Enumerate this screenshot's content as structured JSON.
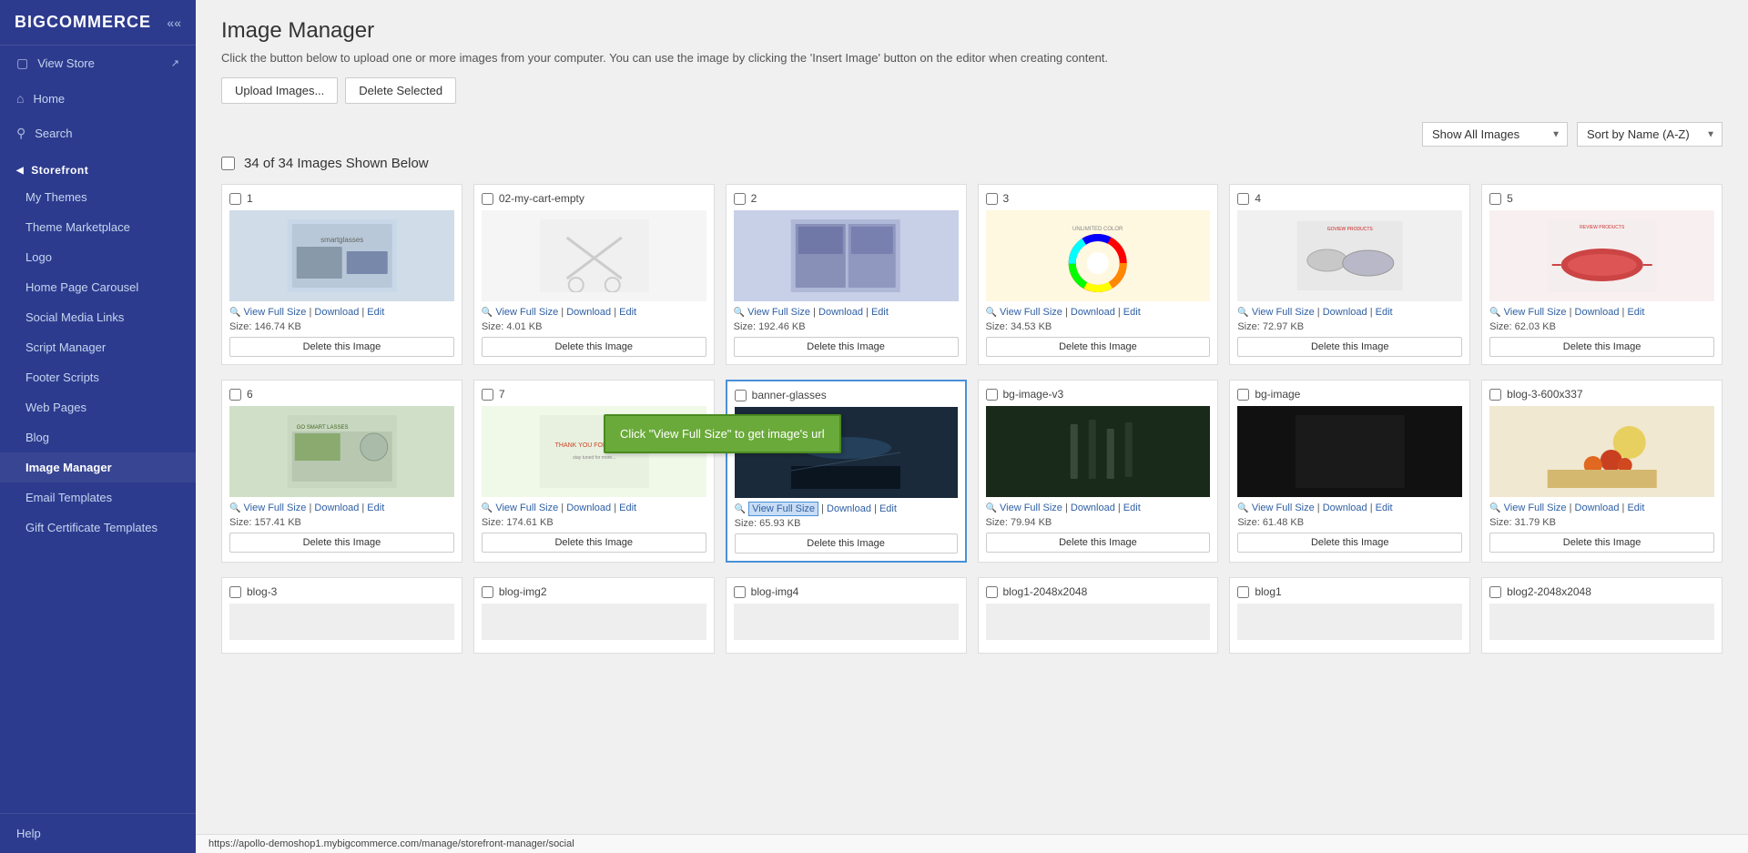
{
  "sidebar": {
    "logo": "BIGCOMMERCE",
    "collapse_icon": "««",
    "nav_items": [
      {
        "id": "view-store",
        "label": "View Store",
        "icon": "🏪"
      },
      {
        "id": "home",
        "label": "Home",
        "icon": "🏠"
      },
      {
        "id": "search",
        "label": "Search",
        "icon": "🔍"
      }
    ],
    "storefront_section": "Storefront",
    "storefront_items": [
      {
        "id": "my-themes",
        "label": "My Themes"
      },
      {
        "id": "theme-marketplace",
        "label": "Theme Marketplace"
      },
      {
        "id": "logo",
        "label": "Logo"
      },
      {
        "id": "home-page-carousel",
        "label": "Home Page Carousel"
      },
      {
        "id": "social-media-links",
        "label": "Social Media Links"
      },
      {
        "id": "script-manager",
        "label": "Script Manager"
      },
      {
        "id": "footer-scripts",
        "label": "Footer Scripts"
      },
      {
        "id": "web-pages",
        "label": "Web Pages"
      },
      {
        "id": "blog",
        "label": "Blog"
      },
      {
        "id": "image-manager",
        "label": "Image Manager",
        "active": true
      },
      {
        "id": "email-templates",
        "label": "Email Templates"
      },
      {
        "id": "gift-certificate-templates",
        "label": "Gift Certificate Templates"
      }
    ],
    "footer_label": "Help"
  },
  "page": {
    "title": "Image Manager",
    "description": "Click the button below to upload one or more images from your computer. You can use the image by clicking the 'Insert Image' button on the editor when creating content.",
    "upload_btn": "Upload Images...",
    "delete_selected_btn": "Delete Selected"
  },
  "filters": {
    "show_filter": "Show All Images",
    "sort_filter": "Sort by Name (A-Z)"
  },
  "images_count": "34 of 34 Images Shown Below",
  "tooltip_text": "Click \"View Full Size\" to get image's url",
  "row1": [
    {
      "name": "1",
      "size": "Size: 146.74 KB",
      "delete_label": "Delete this Image",
      "links": "View Full Size | Download | Edit",
      "color": "#d8e8f0"
    },
    {
      "name": "02-my-cart-empty",
      "size": "Size: 4.01 KB",
      "delete_label": "Delete this Image",
      "links": "View Full Size | Download | Edit",
      "color": "#f5f5f5"
    },
    {
      "name": "2",
      "size": "Size: 192.46 KB",
      "delete_label": "Delete this Image",
      "links": "View Full Size | Download | Edit",
      "color": "#d0d8f0"
    },
    {
      "name": "3",
      "size": "Size: 34.53 KB",
      "delete_label": "Delete this Image",
      "links": "View Full Size | Download | Edit",
      "color": "#fff5e0"
    },
    {
      "name": "4",
      "size": "Size: 72.97 KB",
      "delete_label": "Delete this Image",
      "links": "View Full Size | Download | Edit",
      "color": "#f0f0f0"
    },
    {
      "name": "5",
      "size": "Size: 62.03 KB",
      "delete_label": "Delete this Image",
      "links": "View Full Size | Download | Edit",
      "color": "#f8f0f0"
    }
  ],
  "row2": [
    {
      "name": "6",
      "size": "Size: 157.41 KB",
      "delete_label": "Delete this Image",
      "links": "View Full Size | Download | Edit",
      "color": "#dce8dc"
    },
    {
      "name": "7",
      "size": "Size: 174.61 KB",
      "delete_label": "Delete this Image",
      "links": "View Full Size | Download | Edit",
      "color": "#f0f8f0"
    },
    {
      "name": "banner-glasses",
      "size": "Size: 65.93 KB",
      "delete_label": "Delete this Image",
      "links": "View Full Size | Download | Edit",
      "color": "#1a2a3a",
      "highlighted": true
    },
    {
      "name": "bg-image-v3",
      "size": "Size: 79.94 KB",
      "delete_label": "Delete this Image",
      "links": "View Full Size | Download | Edit",
      "color": "#2a3a2a"
    },
    {
      "name": "bg-image",
      "size": "Size: 61.48 KB",
      "delete_label": "Delete this Image",
      "links": "View Full Size | Download | Edit",
      "color": "#222"
    },
    {
      "name": "blog-3-600x337",
      "size": "Size: 31.79 KB",
      "delete_label": "Delete this Image",
      "links": "View Full Size | Download | Edit",
      "color": "#f0e8d0"
    }
  ],
  "row3_names": [
    "blog-3",
    "blog-img2",
    "blog-img4",
    "blog1-2048x2048",
    "blog1",
    "blog2-2048x2048"
  ],
  "status_bar": "https://apollo-demoshop1.mybigcommerce.com/manage/storefront-manager/social"
}
